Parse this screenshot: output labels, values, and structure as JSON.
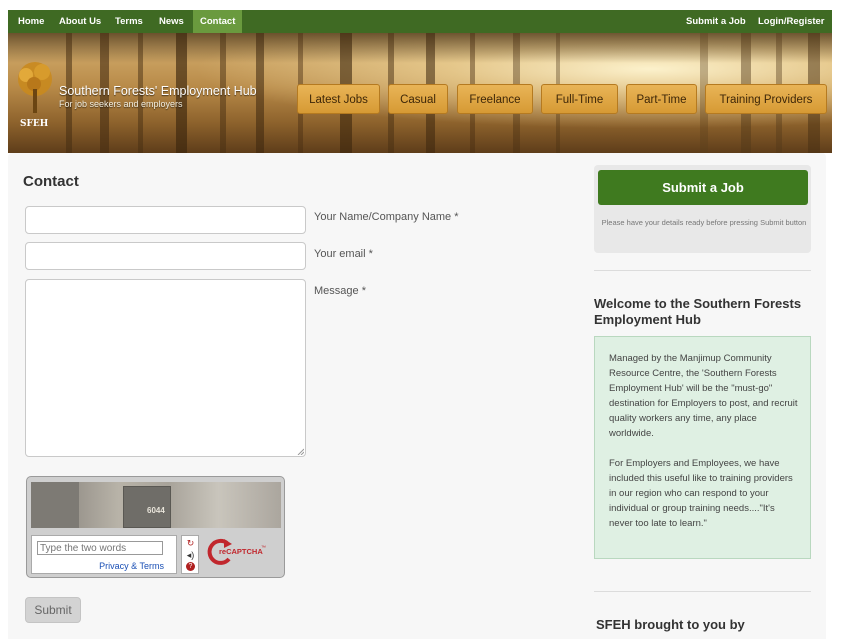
{
  "nav": {
    "left": [
      "Home",
      "About Us",
      "Terms",
      "News",
      "Contact"
    ],
    "active": "Contact",
    "right": [
      "Submit a Job",
      "Login/Register"
    ]
  },
  "header": {
    "logo_text": "SFEH",
    "title": "Southern Forests' Employment Hub",
    "tagline": "For job seekers and employers",
    "categories": [
      "Latest Jobs",
      "Casual",
      "Freelance",
      "Full-Time",
      "Part-Time",
      "Training Providers"
    ]
  },
  "contact": {
    "title": "Contact",
    "name_label": "Your Name/Company Name *",
    "name_value": "",
    "email_label": "Your email *",
    "email_value": "",
    "message_label": "Message *",
    "message_value": "",
    "submit_label": "Submit"
  },
  "captcha": {
    "image_text": "6044",
    "placeholder": "Type the two words",
    "privacy_link": "Privacy & Terms",
    "brand": "reCAPTCHA",
    "brand_tm": "™"
  },
  "sidebar": {
    "submit_job_label": "Submit a Job",
    "submit_hint": "Please have your details ready before pressing Submit button",
    "welcome_title": "Welcome to the Southern Forests Employment Hub",
    "welcome_p1": "Managed by the Manjimup Community Resource Centre, the 'Southern Forests Employment Hub' will be the \"must-go\" destination for Employers to post, and recruit quality workers any time, any place worldwide.",
    "welcome_p2": "For Employers and Employees, we have included this useful like to training providers in our region who can respond to your individual or group training needs....\"It's never too late to learn.\"",
    "brought_title": "SFEH brought to you by"
  },
  "colors": {
    "nav_bg": "#3f6a23",
    "nav_active": "#6a9a3e",
    "category_button": "#d69a34",
    "submit_job_button": "#3f7a1f",
    "welcome_box_bg": "#dff0e3"
  }
}
